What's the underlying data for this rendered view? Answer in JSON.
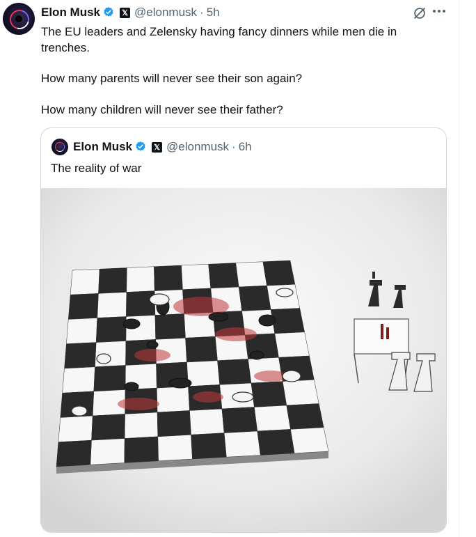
{
  "tweet": {
    "author_name": "Elon Musk",
    "handle": "@elonmusk",
    "separator": "·",
    "time": "5h",
    "lines": [
      "The EU leaders and Zelensky having fancy dinners while men die in trenches.",
      "How many parents will never see their son again?",
      "How many children will never see their father?"
    ],
    "icons": {
      "grok": "grok-icon",
      "more": "more-icon",
      "verified": "verified-badge-icon",
      "affiliation": "x-logo-icon"
    }
  },
  "quoted": {
    "author_name": "Elon Musk",
    "handle": "@elonmusk",
    "separator": "·",
    "time": "6h",
    "text": "The reality of war",
    "image": "illustration-chessboard-fallen-pieces-kings-dining"
  },
  "colors": {
    "verified_blue": "#1d9bf0",
    "secondary_text": "#536471",
    "border": "#cfd9de"
  }
}
